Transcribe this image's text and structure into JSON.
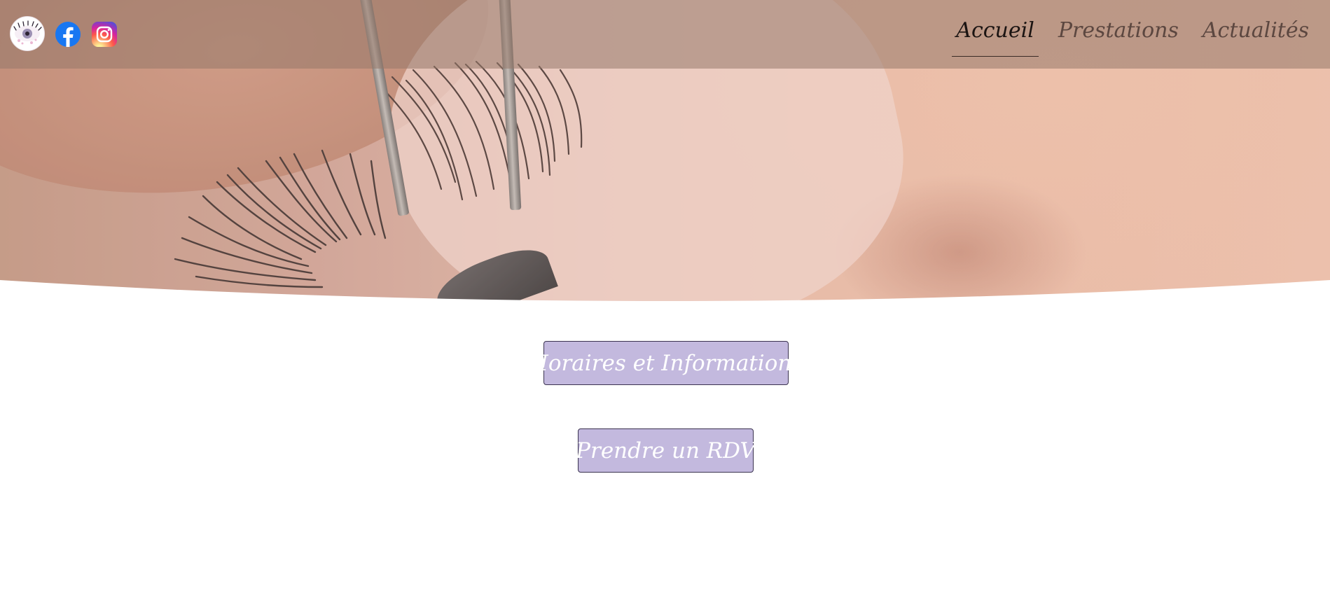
{
  "header": {
    "logo_icon": "eye-lash-logo-icon",
    "social": [
      {
        "name": "facebook-icon",
        "color": "#1877f2"
      },
      {
        "name": "instagram-icon",
        "color": "#d6249f"
      }
    ]
  },
  "nav": {
    "items": [
      {
        "label": "Accueil",
        "active": true
      },
      {
        "label": "Prestations",
        "active": false
      },
      {
        "label": "Actualités",
        "active": false
      }
    ]
  },
  "hero": {
    "image": "eyelash-extension-closeup-photo"
  },
  "actions": {
    "info_label": "Horaires et Informations",
    "rdv_label": "Prendre un RDV"
  },
  "colors": {
    "button_bg": "#c3b9de",
    "button_border": "#3b3350",
    "header_bg": "#96786980"
  }
}
